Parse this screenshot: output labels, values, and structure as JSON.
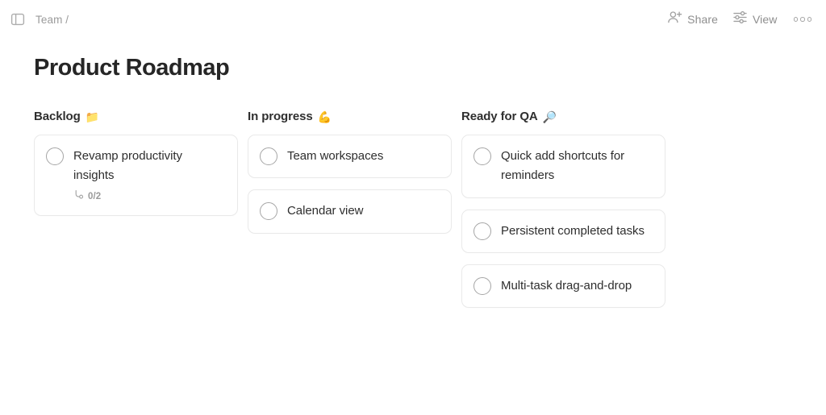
{
  "topbar": {
    "panel_toggle_icon": "sidebar-panel-icon",
    "breadcrumb": "Team /",
    "share": {
      "label": "Share",
      "icon": "person-plus-icon"
    },
    "view": {
      "label": "View",
      "icon": "sliders-icon"
    },
    "more": {
      "icon": "ellipsis-icon"
    }
  },
  "page": {
    "title": "Product Roadmap"
  },
  "board": {
    "columns": [
      {
        "name": "backlog",
        "title": "Backlog",
        "emoji": "📁",
        "emoji_name": "folder-emoji",
        "cards": [
          {
            "title": "Revamp productivity insights",
            "checked": false,
            "subtasks": "0/2",
            "subtask_icon": "subtask-branch-icon"
          }
        ]
      },
      {
        "name": "in-progress",
        "title": "In progress",
        "emoji": "💪",
        "emoji_name": "flexed-biceps-emoji",
        "cards": [
          {
            "title": "Team workspaces",
            "checked": false
          },
          {
            "title": "Calendar view",
            "checked": false
          }
        ]
      },
      {
        "name": "ready-for-qa",
        "title": "Ready for QA",
        "emoji": "🔎",
        "emoji_name": "magnifying-glass-emoji",
        "cards": [
          {
            "title": "Quick add shortcuts for reminders",
            "checked": false
          },
          {
            "title": "Persistent completed tasks",
            "checked": false
          },
          {
            "title": "Multi-task drag-and-drop",
            "checked": false
          }
        ]
      }
    ]
  },
  "colors": {
    "background": "#ffffff",
    "text": "#2e2e2e",
    "muted": "#9b9b9b",
    "card_border": "#e9e9e9",
    "checkbox_border": "#a5a5a5"
  }
}
